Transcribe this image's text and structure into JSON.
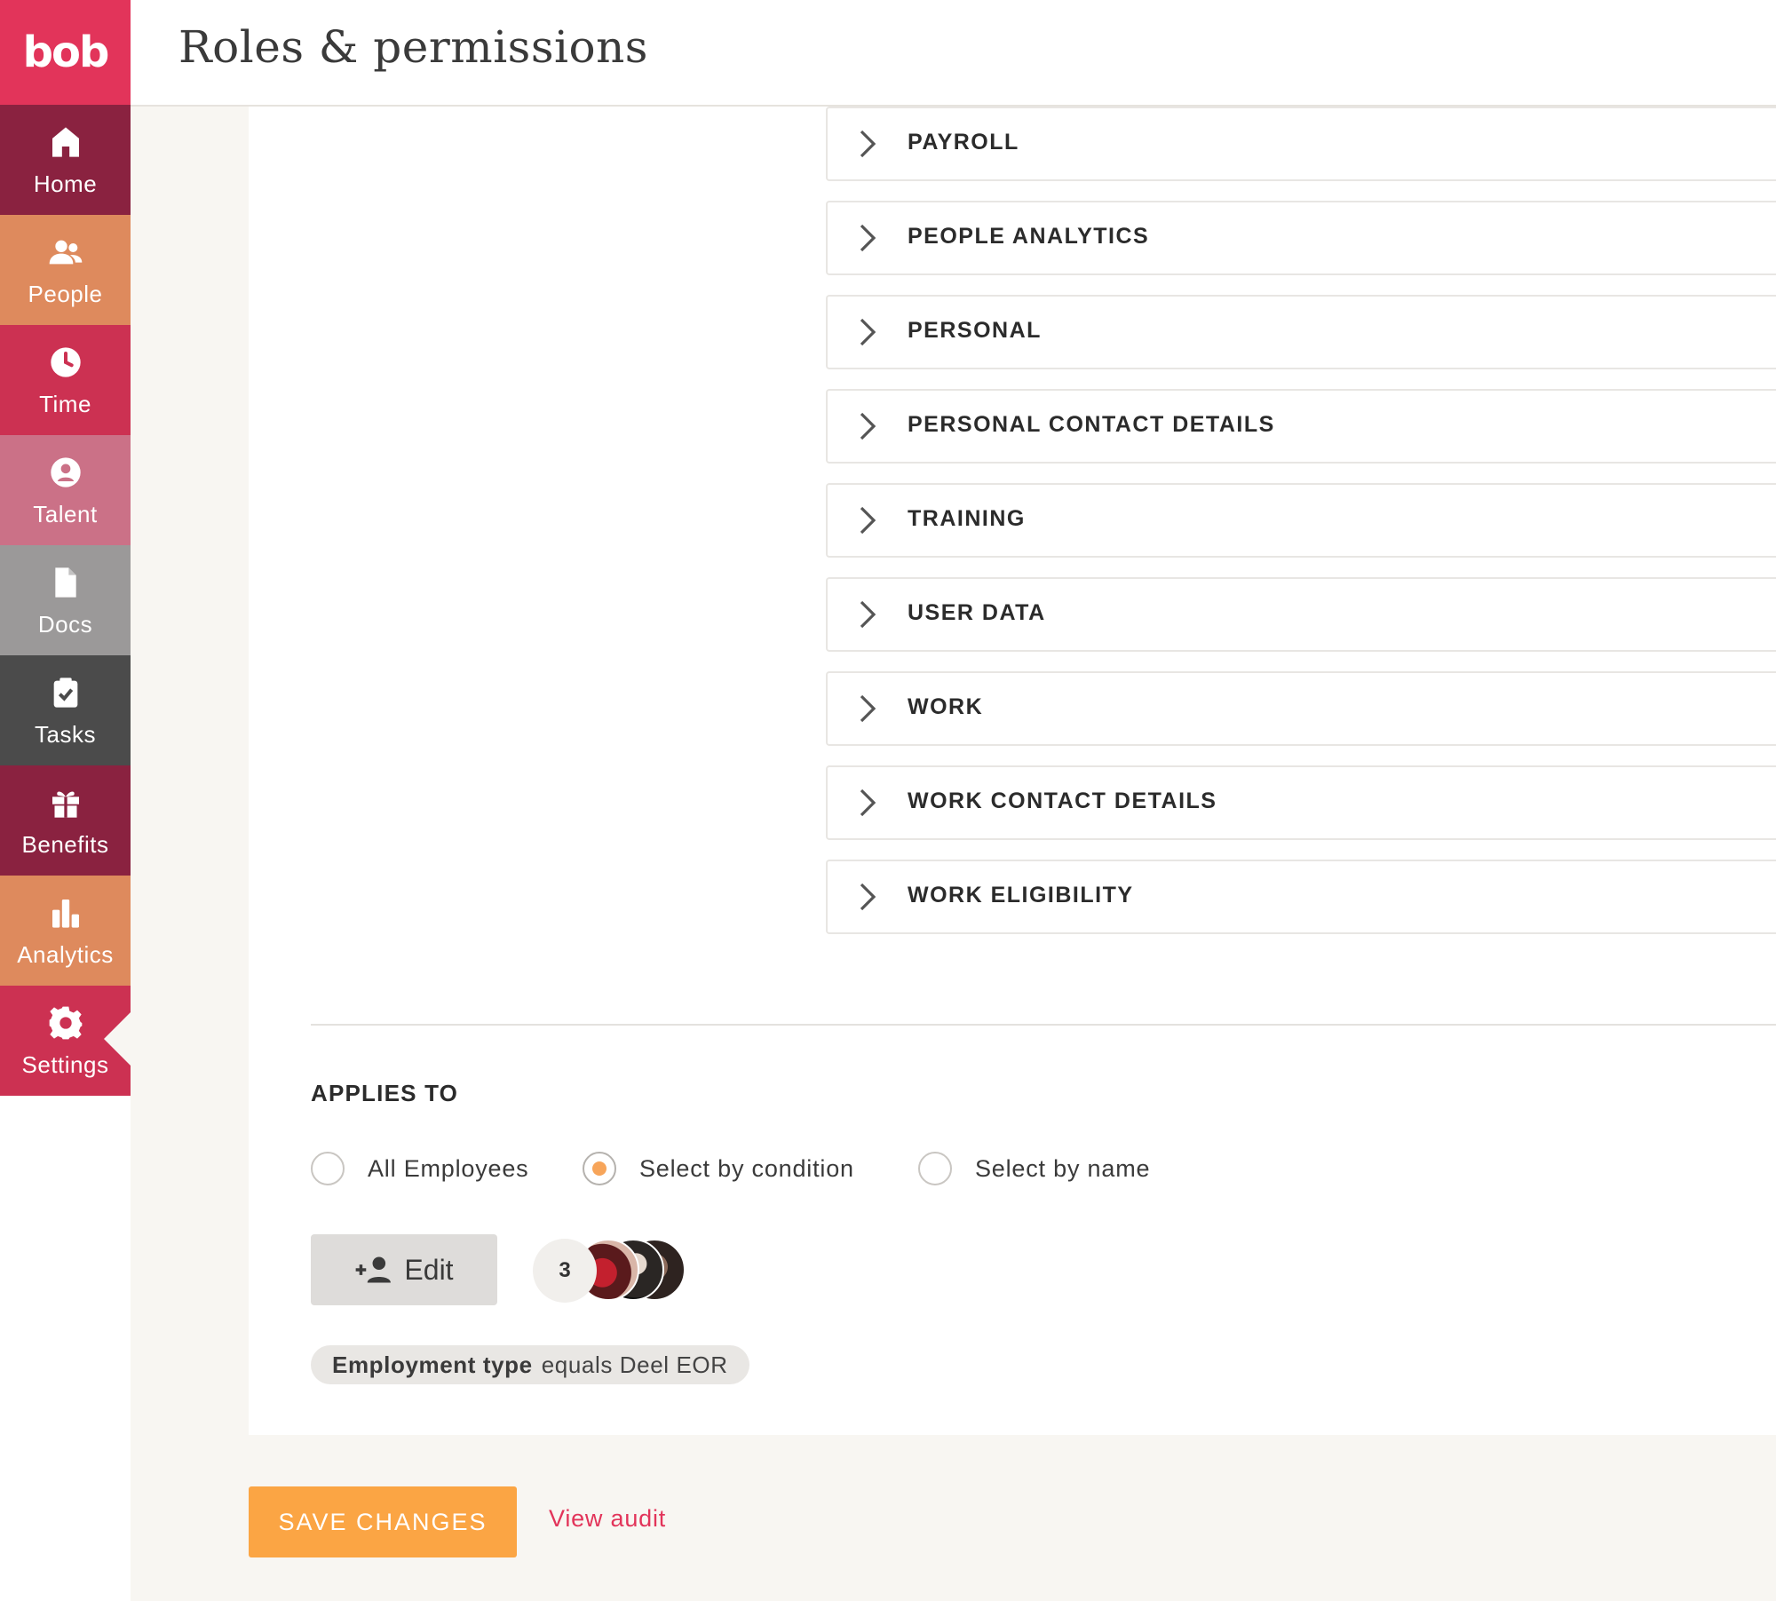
{
  "app": {
    "logo_text": "bob",
    "brand_color": "#e2345a"
  },
  "header": {
    "title": "Roles & permissions"
  },
  "sidebar": {
    "items": [
      {
        "label": "Home",
        "icon": "home-icon",
        "color": "#8a2240"
      },
      {
        "label": "People",
        "icon": "people-icon",
        "color": "#de8a5d"
      },
      {
        "label": "Time",
        "icon": "clock-icon",
        "color": "#cc3152"
      },
      {
        "label": "Talent",
        "icon": "talent-icon",
        "color": "#cb7187"
      },
      {
        "label": "Docs",
        "icon": "document-icon",
        "color": "#9b9999"
      },
      {
        "label": "Tasks",
        "icon": "clipboard-check-icon",
        "color": "#4b4b4b"
      },
      {
        "label": "Benefits",
        "icon": "gift-icon",
        "color": "#8a2240"
      },
      {
        "label": "Analytics",
        "icon": "bar-chart-icon",
        "color": "#de8a5d"
      },
      {
        "label": "Settings",
        "icon": "gear-icon",
        "color": "#cc3152",
        "active": true
      }
    ]
  },
  "sections": [
    "PAYROLL",
    "PEOPLE ANALYTICS",
    "PERSONAL",
    "PERSONAL CONTACT DETAILS",
    "TRAINING",
    "USER DATA",
    "WORK",
    "WORK CONTACT DETAILS",
    "WORK ELIGIBILITY"
  ],
  "applies_to": {
    "title": "APPLIES TO",
    "options": [
      {
        "label": "All Employees",
        "checked": false
      },
      {
        "label": "Select by condition",
        "checked": true
      },
      {
        "label": "Select by name",
        "checked": false
      }
    ],
    "edit_label": "Edit",
    "member_count": "3",
    "condition": {
      "field": "Employment type",
      "rest": "equals Deel EOR"
    }
  },
  "footer": {
    "save_label": "SAVE CHANGES",
    "audit_label": "View audit"
  },
  "colors": {
    "accent_orange": "#fba544",
    "radio_dot": "#f7a55a"
  }
}
